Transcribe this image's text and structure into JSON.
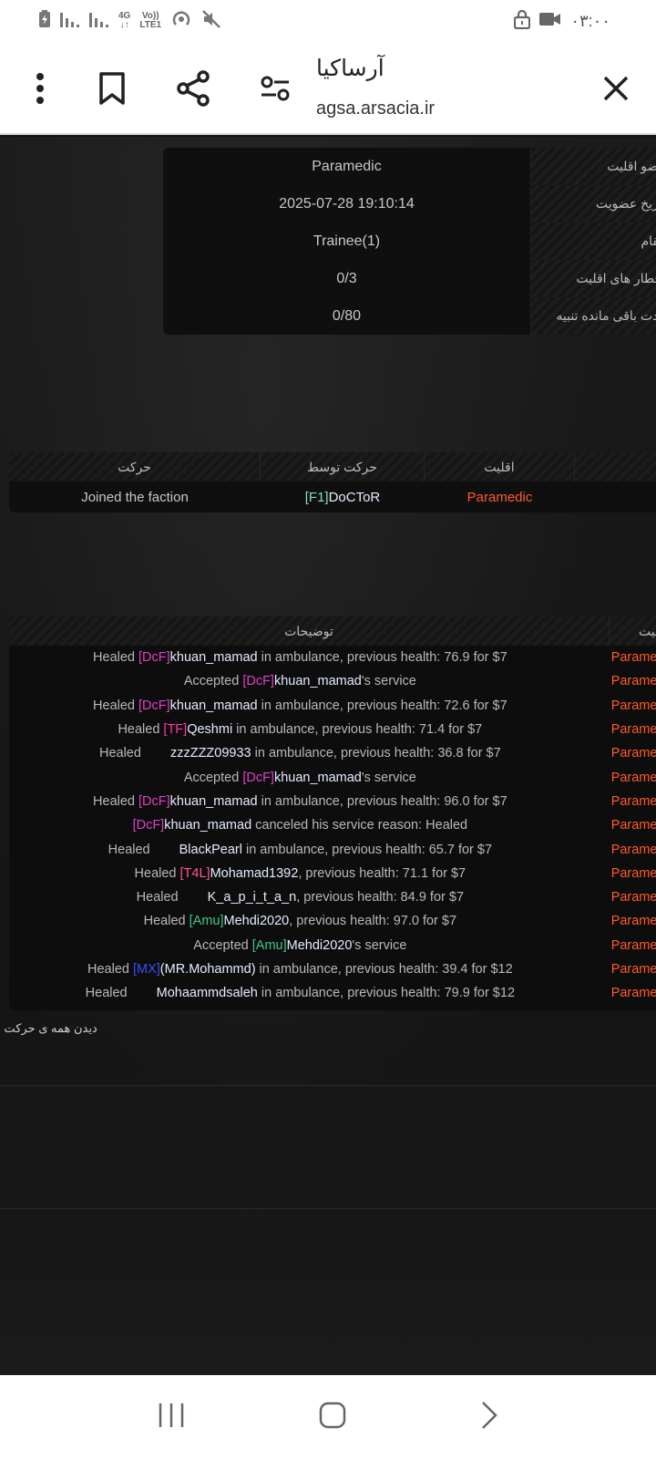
{
  "status_bar": {
    "network_left": "4G",
    "volte": "Vo))",
    "lte": "LTE1",
    "time": "۰۳:۰۰"
  },
  "browser": {
    "title": "آرساکیا",
    "url": "agsa.arsacia.ir"
  },
  "member_info": {
    "rows": [
      {
        "label": "عضو اقلیت",
        "value": "Paramedic"
      },
      {
        "label": "تاریخ عضویت",
        "value": "2025-07-28 19:10:14"
      },
      {
        "label": "مقام",
        "value": "Trainee(1)"
      },
      {
        "label": "اخطار های اقلیت",
        "value": "0/3"
      },
      {
        "label": "مدت باقی مانده تنبیه",
        "value": "0/80"
      }
    ]
  },
  "history": {
    "headers": {
      "action": "حرکت",
      "by": "حرکت توسط",
      "faction": "اقلیت"
    },
    "rows": [
      {
        "action": "Joined the faction",
        "by_tag": "[F1]",
        "by_name": "DoCToR",
        "faction": "Paramedic"
      }
    ]
  },
  "logs": {
    "headers": {
      "description": "توضیحات",
      "faction": "اقلیت"
    },
    "rows": [
      {
        "pre": "Healed ",
        "tag": "[DcF]",
        "name": "khuan_mamad",
        "post": " in ambulance, previous health: 76.9 for $7",
        "faction": "Paramedic"
      },
      {
        "pre": "Accepted ",
        "tag": "[DcF]",
        "name": "khuan_mamad",
        "post": "'s service",
        "faction": "Paramedic"
      },
      {
        "pre": "Healed ",
        "tag": "[DcF]",
        "name": "khuan_mamad",
        "post": " in ambulance, previous health: 72.6 for $7",
        "faction": "Paramedic"
      },
      {
        "pre": "Healed ",
        "tag": "[TF]",
        "name": "Qeshmi",
        "post": " in ambulance, previous health: 71.4 for $7",
        "faction": "Paramedic"
      },
      {
        "pre": "Healed ",
        "tag": "",
        "name": "zzzZZZ09933",
        "post": " in ambulance, previous health: 36.8 for $7",
        "faction": "Paramedic"
      },
      {
        "pre": "Accepted ",
        "tag": "[DcF]",
        "name": "khuan_mamad",
        "post": "'s service",
        "faction": "Paramedic"
      },
      {
        "pre": "Healed ",
        "tag": "[DcF]",
        "name": "khuan_mamad",
        "post": " in ambulance, previous health: 96.0 for $7",
        "faction": "Paramedic"
      },
      {
        "pre": "",
        "tag": "[DcF]",
        "name": "khuan_mamad",
        "post": " canceled his service reason: Healed",
        "faction": "Paramedic"
      },
      {
        "pre": "Healed ",
        "tag": "",
        "name": "BlackPearl",
        "post": " in ambulance, previous health: 65.7 for $7",
        "faction": "Paramedic"
      },
      {
        "pre": "Healed ",
        "tag": "[T4L]",
        "name": "Mohamad1392",
        "post": ", previous health: 71.1 for $7",
        "faction": "Paramedic"
      },
      {
        "pre": "Healed ",
        "tag": "",
        "name": "K_a_p_i_t_a_n",
        "post": ", previous health: 84.9 for $7",
        "faction": "Paramedic"
      },
      {
        "pre": "Healed ",
        "tag": "[Amu]",
        "name": "Mehdi2020",
        "post": ", previous health: 97.0 for $7",
        "faction": "Paramedic"
      },
      {
        "pre": "Accepted ",
        "tag": "[Amu]",
        "name": "Mehdi2020",
        "post": "'s service",
        "faction": "Paramedic"
      },
      {
        "pre": "Healed ",
        "tag": "[MX]",
        "name": "(MR.Mohammd)",
        "post": " in ambulance, previous health: 39.4 for $12",
        "faction": "Paramedic"
      },
      {
        "pre": "Healed ",
        "tag": "",
        "name": "Mohaammdsaleh",
        "post": " in ambulance, previous health: 79.9 for $12",
        "faction": "Paramedic"
      }
    ]
  },
  "view_all_link": "دیدن همه ی حرکت ها",
  "colors": {
    "faction_red": "#ff5a2a",
    "tag_DcF": "#e040c8",
    "tag_TF": "#ff3aa8",
    "tag_T4L": "#ff5a8a",
    "tag_Amu": "#3fc88a",
    "tag_MX": "#3b4dff",
    "tag_F1": "#7fe0b8"
  }
}
